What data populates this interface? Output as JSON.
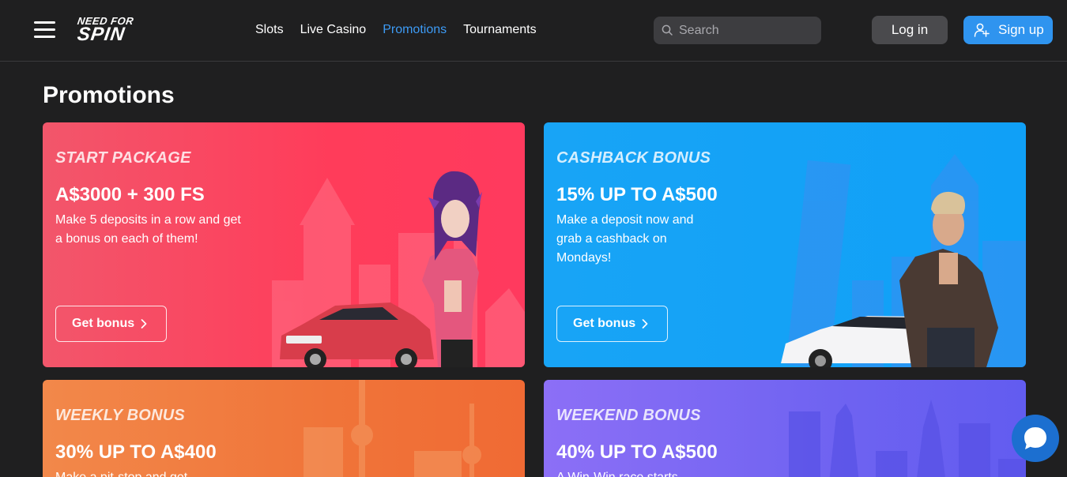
{
  "header": {
    "logo": {
      "line1": "NEED FOR",
      "line2": "SPIN"
    },
    "nav": [
      "Slots",
      "Live Casino",
      "Promotions",
      "Tournaments"
    ],
    "active_nav": "Promotions",
    "search": {
      "placeholder": "Search",
      "value": ""
    },
    "login_label": "Log in",
    "signup_label": "Sign up",
    "icons": {
      "menu": "hamburger-icon",
      "search": "search-icon",
      "signup": "user-plus-icon"
    }
  },
  "page": {
    "title": "Promotions"
  },
  "promotions": [
    {
      "subtitle": "START PACKAGE",
      "amount": "A$3000 + 300 FS",
      "description": "Make 5 deposits in a row and get a bonus on each of them!",
      "button": "Get bonus",
      "color": "#ff3c5a"
    },
    {
      "subtitle": "CASHBACK BONUS",
      "amount": "15% UP TO A$500",
      "description": "Make a deposit now and grab a cashback on Mondays!",
      "button": "Get bonus",
      "color": "#10a0f7"
    },
    {
      "subtitle": "WEEKLY BONUS",
      "amount": "30% UP TO A$400",
      "description": "Make a pit-stop and get",
      "color": "#f07439"
    },
    {
      "subtitle": "WEEKEND BONUS",
      "amount": "40% UP TO A$500",
      "description": "A Win-Win race starts",
      "color": "#6f63f1"
    }
  ],
  "chat": {
    "icon": "chat-bubble-icon",
    "color": "#1c6fd0"
  },
  "colors": {
    "background": "#1f1f20",
    "accent": "#2f94ef",
    "active_nav": "#3d9bf5"
  }
}
